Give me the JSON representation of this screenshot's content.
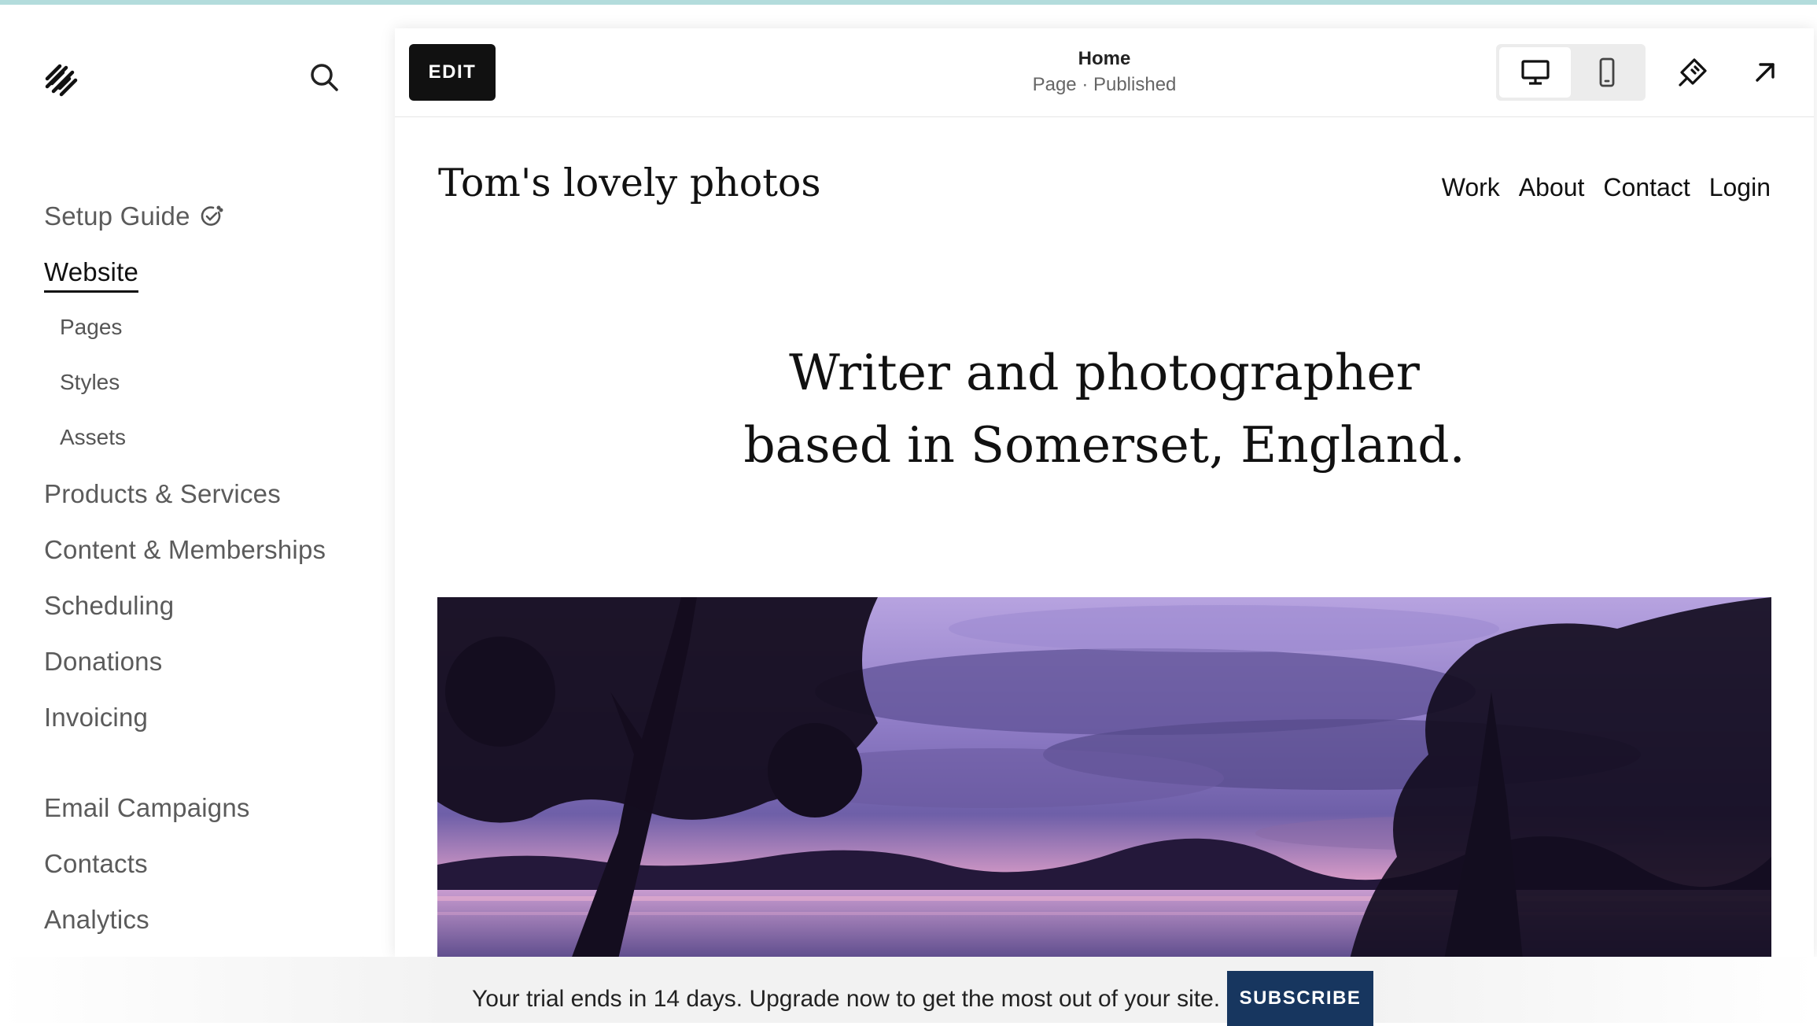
{
  "colors": {
    "accent": "#17365f",
    "topStrip": "#b3dcdc",
    "editButton": "#111111"
  },
  "sidebar": {
    "primary": [
      {
        "label": "Setup Guide",
        "icon": "setup-guide-icon"
      },
      {
        "label": "Website",
        "active": true
      }
    ],
    "website_sub": [
      {
        "label": "Pages"
      },
      {
        "label": "Styles"
      },
      {
        "label": "Assets"
      }
    ],
    "secondary": [
      {
        "label": "Products & Services"
      },
      {
        "label": "Content & Memberships"
      },
      {
        "label": "Scheduling"
      },
      {
        "label": "Donations"
      },
      {
        "label": "Invoicing"
      }
    ],
    "tertiary": [
      {
        "label": "Email Campaigns"
      },
      {
        "label": "Contacts"
      },
      {
        "label": "Analytics"
      }
    ]
  },
  "preview": {
    "edit_label": "EDIT",
    "page_title": "Home",
    "page_status": "Page · Published",
    "view_mode": "desktop"
  },
  "site": {
    "title": "Tom's lovely photos",
    "nav": [
      "Work",
      "About",
      "Contact",
      "Login"
    ],
    "hero_line1": "Writer and photographer",
    "hero_line2": "based in Somerset, England."
  },
  "banner": {
    "text": "Your trial ends in 14 days. Upgrade now to get the most out of your site.",
    "button_label": "SUBSCRIBE"
  }
}
